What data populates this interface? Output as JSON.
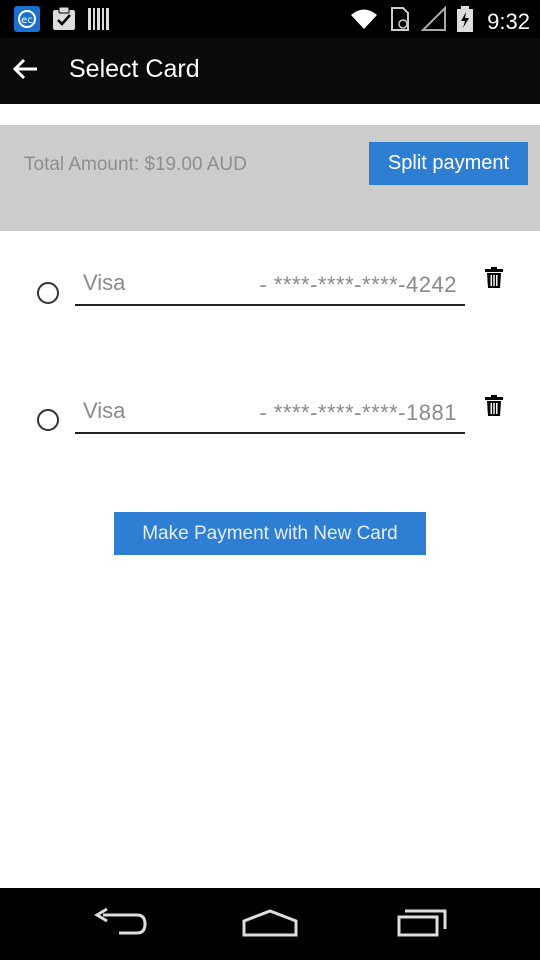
{
  "status_bar": {
    "time": "9:32",
    "icons": [
      "app-icon",
      "clipboard-check-icon",
      "barcode-icon",
      "wifi-icon",
      "sim-icon",
      "signal-icon",
      "battery-charging-icon"
    ]
  },
  "app_bar": {
    "back_icon": "arrow-back-icon",
    "title": "Select Card"
  },
  "summary": {
    "total_label": "Total Amount: $19.00 AUD",
    "split_button": "Split payment"
  },
  "cards": [
    {
      "brand": "Visa",
      "number": "- ****-****-****-4242",
      "selected": false,
      "delete_icon": "trash-icon"
    },
    {
      "brand": "Visa",
      "number": "- ****-****-****-1881",
      "selected": false,
      "delete_icon": "trash-icon"
    }
  ],
  "new_card_button": "Make Payment with New Card",
  "nav_bar": {
    "icons": [
      "back-nav-icon",
      "home-nav-icon",
      "recents-nav-icon"
    ]
  },
  "colors": {
    "accent": "#2e7fd3",
    "summary_bg": "#cccccc",
    "app_bar_bg": "#0b0b0b",
    "muted_text": "#8e8e8e"
  }
}
